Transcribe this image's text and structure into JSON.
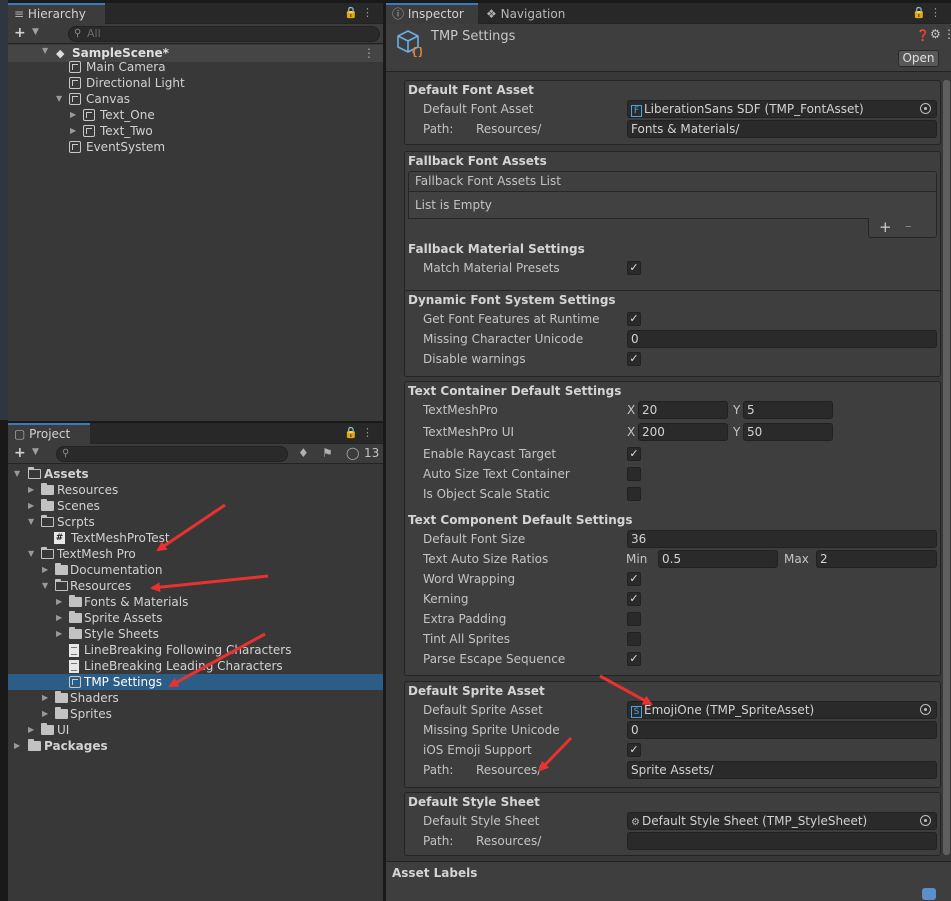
{
  "hierarchy": {
    "tab": "Hierarchy",
    "search_placeholder": "All",
    "scene": "SampleScene*",
    "items": [
      "Main Camera",
      "Directional Light",
      "Canvas",
      "Text_One",
      "Text_Two",
      "EventSystem"
    ]
  },
  "project": {
    "tab": "Project",
    "hidden_count": "13",
    "items": [
      "Assets",
      "Resources",
      "Scenes",
      "Scrpts",
      "TextMeshProTest",
      "TextMesh Pro",
      "Documentation",
      "Resources",
      "Fonts & Materials",
      "Sprite Assets",
      "Style Sheets",
      "LineBreaking Following Characters",
      "LineBreaking Leading Characters",
      "TMP Settings",
      "Shaders",
      "Sprites",
      "UI",
      "Packages"
    ]
  },
  "inspector": {
    "tabs": [
      "Inspector",
      "Navigation"
    ],
    "title": "TMP Settings",
    "open_button": "Open",
    "default_font": {
      "section": "Default Font Asset",
      "label": "Default Font Asset",
      "value": "LiberationSans SDF (TMP_FontAsset)",
      "path_label": "Path:",
      "path_prefix": "Resources/",
      "path_value": "Fonts & Materials/"
    },
    "fallback": {
      "section": "Fallback Font Assets",
      "list_header": "Fallback Font Assets List",
      "list_empty": "List is Empty",
      "add": "+",
      "remove": "–"
    },
    "fallback_material": {
      "section": "Fallback Material Settings",
      "match_label": "Match Material Presets"
    },
    "dynamic_font": {
      "section": "Dynamic Font System Settings",
      "features_label": "Get Font Features at Runtime",
      "missing_label": "Missing Character Unicode",
      "missing_value": "0",
      "warnings_label": "Disable warnings"
    },
    "text_container": {
      "section": "Text Container Default Settings",
      "tmp_label": "TextMeshPro",
      "tmp_x": "20",
      "tmp_y": "5",
      "tmpui_label": "TextMeshPro UI",
      "tmpui_x": "200",
      "tmpui_y": "50",
      "x_label": "X",
      "y_label": "Y",
      "raycast_label": "Enable Raycast Target",
      "autosize_label": "Auto Size Text Container",
      "static_label": "Is Object Scale Static"
    },
    "text_component": {
      "section": "Text Component Default Settings",
      "font_size_label": "Default Font Size",
      "font_size_value": "36",
      "ratios_label": "Text Auto Size Ratios",
      "min_label": "Min",
      "min_value": "0.5",
      "max_label": "Max",
      "max_value": "2",
      "word_wrap_label": "Word Wrapping",
      "kerning_label": "Kerning",
      "padding_label": "Extra Padding",
      "tint_label": "Tint All Sprites",
      "escape_label": "Parse Escape Sequence"
    },
    "sprite": {
      "section": "Default Sprite Asset",
      "label": "Default Sprite Asset",
      "value": "EmojiOne (TMP_SpriteAsset)",
      "missing_label": "Missing Sprite Unicode",
      "missing_value": "0",
      "emoji_label": "iOS Emoji Support",
      "path_label": "Path:",
      "path_prefix": "Resources/",
      "path_value": "Sprite Assets/"
    },
    "style": {
      "section": "Default Style Sheet",
      "label": "Default Style Sheet",
      "value": "Default Style Sheet (TMP_StyleSheet)",
      "path_label": "Path:",
      "path_prefix": "Resources/",
      "path_value": ""
    },
    "asset_labels": "Asset Labels",
    "checkmark": "✓"
  },
  "colors": {
    "accent": "#3a79bb",
    "selection": "#2c5d87",
    "arrow": "#e8322f"
  }
}
